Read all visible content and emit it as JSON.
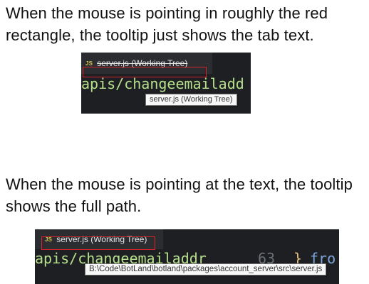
{
  "captions": {
    "first": "When the mouse is pointing in roughly the red rectangle, the tooltip just shows the tab text.",
    "second": "When the mouse is pointing at the text, the tooltip shows the full path."
  },
  "screenshot1": {
    "tab_icon": "JS",
    "tab_label": "server.js (Working Tree)",
    "code_text": "apis/changeemailadd",
    "tooltip": "server.js (Working Tree)"
  },
  "screenshot2": {
    "tab_icon": "JS",
    "tab_label": "server.js (Working Tree)",
    "code_text": "apis/changeemailaddr",
    "code_num": "63",
    "code_brace": "}",
    "code_kw": "fro",
    "tooltip": "B:\\Code\\BotLand\\botland\\packages\\account_server\\src\\server.js"
  },
  "colors": {
    "highlight_rect": "#d9232d",
    "editor_bg": "#1e1f22",
    "code_green": "#b5e08c",
    "js_icon": "#d8c34a"
  }
}
